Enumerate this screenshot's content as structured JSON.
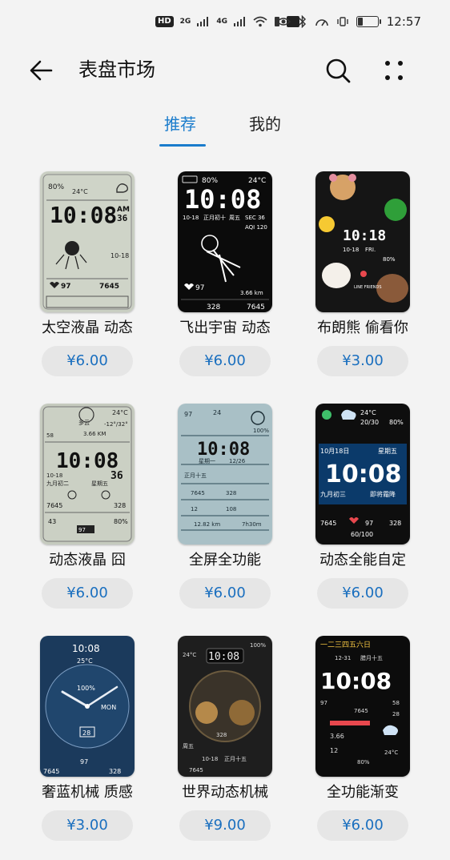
{
  "status_bar": {
    "hd_label": "HD",
    "network_1": "2G",
    "network_2": "4G",
    "time": "12:57"
  },
  "app_bar": {
    "title": "表盘市场",
    "icons": {
      "back": "back-arrow-icon",
      "search": "search-icon",
      "more": "more-dots-icon"
    }
  },
  "tabs": [
    {
      "label": "推荐",
      "active": true
    },
    {
      "label": "我的",
      "active": false
    }
  ],
  "watch_faces": [
    {
      "name": "太空液晶 动态",
      "price": "¥6.00",
      "preview": {
        "time": "10:08",
        "extra": [
          "36",
          "AM",
          "80%",
          "24°C",
          "10-18",
          "97",
          "7645"
        ]
      }
    },
    {
      "name": "飞出宇宙 动态",
      "price": "¥6.00",
      "preview": {
        "time": "10:08",
        "extra": [
          "80%",
          "24°C",
          "10-18",
          "正月初十",
          "周五",
          "SEC 36",
          "AQI 120",
          "97",
          "3.66 km",
          "328",
          "7645"
        ]
      }
    },
    {
      "name": "布朗熊 偷看你",
      "price": "¥3.00",
      "preview": {
        "time": "10:18",
        "extra": [
          "LINE FRIENDS",
          "10-18",
          "FRI.",
          "80%"
        ]
      }
    },
    {
      "name": "动态液晶 囧",
      "price": "¥6.00",
      "preview": {
        "time": "10:08",
        "extra": [
          "24°C",
          "多云",
          "-12°/32°",
          "58",
          "3.66 KM",
          "10-18",
          "36",
          "九月初二",
          "星期五",
          "7645",
          "328",
          "43",
          "80%",
          "97"
        ]
      }
    },
    {
      "name": "全屏全功能",
      "price": "¥6.00",
      "preview": {
        "time": "10:08",
        "extra": [
          "97",
          "24",
          "100%",
          "星期一",
          "12/26",
          "正月十五",
          "7645",
          "328",
          "12",
          "108",
          "12.82 km",
          "7h30m"
        ]
      }
    },
    {
      "name": "动态全能自定",
      "price": "¥6.00",
      "preview": {
        "time": "10:08",
        "extra": [
          "24°C",
          "20/30",
          "80%",
          "10月18日",
          "星期五",
          "九月初三",
          "即将霜降",
          "7645",
          "97",
          "328",
          "60/100"
        ]
      }
    },
    {
      "name": "奢蓝机械 质感",
      "price": "¥3.00",
      "preview": {
        "time": "10:08",
        "extra": [
          "25°C",
          "100%",
          "MON",
          "28",
          "7645",
          "97",
          "328"
        ]
      }
    },
    {
      "name": "世界动态机械",
      "price": "¥9.00",
      "preview": {
        "time": "10:08",
        "extra": [
          "100%",
          "24°C",
          "328",
          "周五",
          "10-18",
          "正月十五",
          "7645"
        ]
      }
    },
    {
      "name": "全功能渐变",
      "price": "¥6.00",
      "preview": {
        "time": "10:08",
        "extra": [
          "一二三四五六日",
          "12-31",
          "腊月十五",
          "97",
          "7645",
          "58",
          "28",
          "3.66",
          "12",
          "80%",
          "24°C"
        ]
      }
    }
  ],
  "colors": {
    "accent": "#1a7ccc",
    "price_text": "#1a6fbf",
    "price_bg": "#e6e6e6",
    "background": "#f3f3f3"
  }
}
